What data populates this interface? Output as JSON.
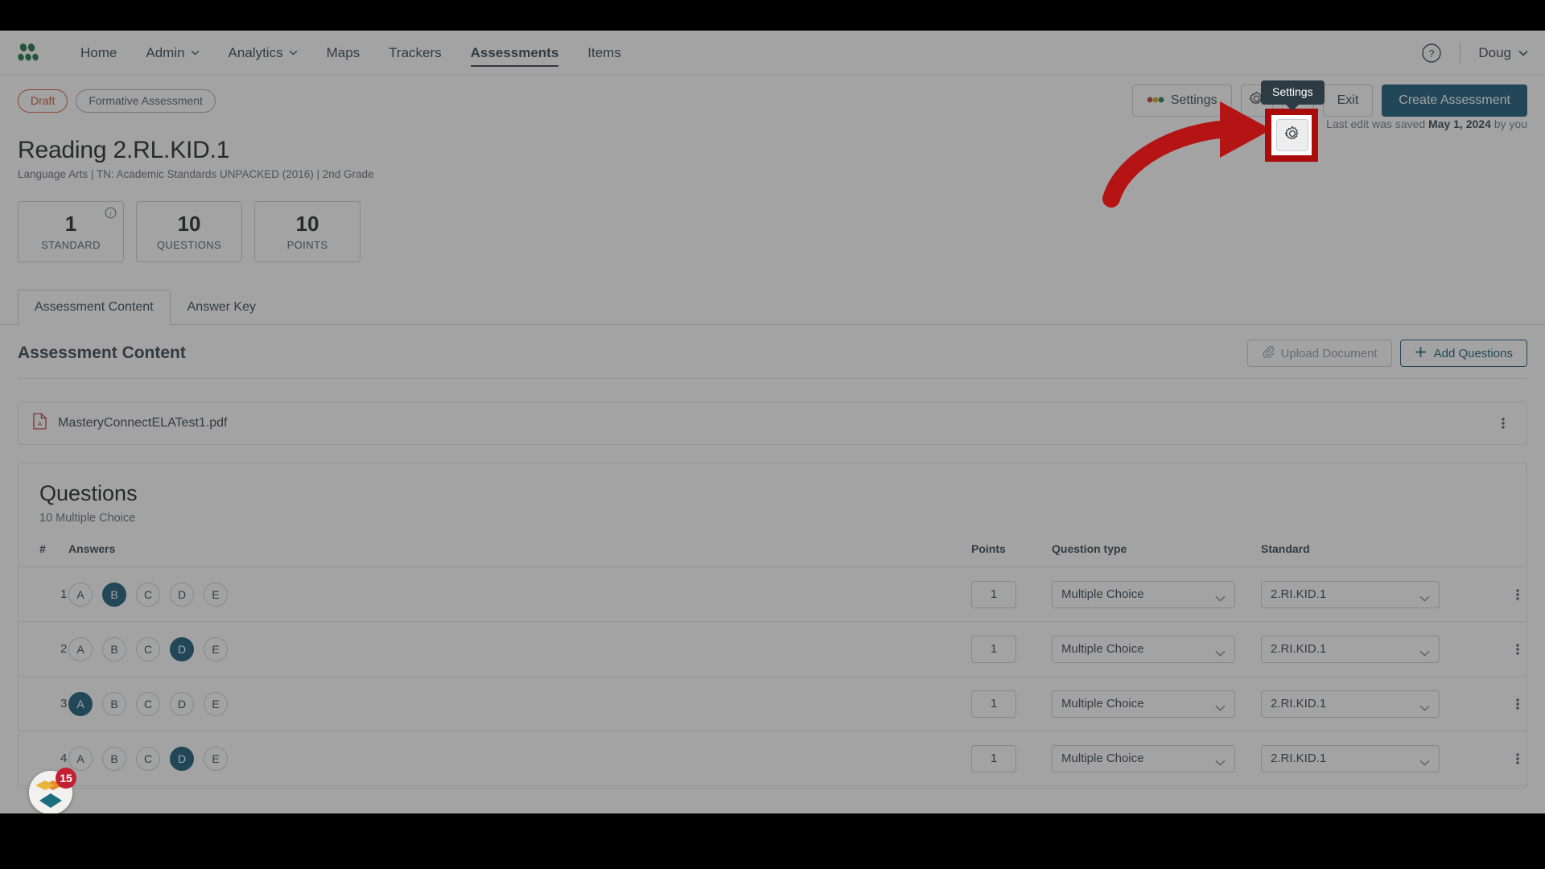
{
  "topnav": {
    "logo_icon": "instructure-logo-icon",
    "items": [
      {
        "label": "Home",
        "has_caret": false,
        "active": false
      },
      {
        "label": "Admin",
        "has_caret": true,
        "active": false
      },
      {
        "label": "Analytics",
        "has_caret": true,
        "active": false
      },
      {
        "label": "Maps",
        "has_caret": false,
        "active": false
      },
      {
        "label": "Trackers",
        "has_caret": false,
        "active": false
      },
      {
        "label": "Assessments",
        "has_caret": false,
        "active": true
      },
      {
        "label": "Items",
        "has_caret": false,
        "active": false
      }
    ],
    "help_icon": "help-circle-icon",
    "user_name": "Doug",
    "user_caret_icon": "chevron-down-icon"
  },
  "actionbar": {
    "status_pill": "Draft",
    "type_pill": "Formative Assessment",
    "settings_label": "Settings",
    "settings_gear_icon": "gear-icon",
    "more_icon": "kebab-vertical-icon",
    "exit_label": "Exit",
    "create_label": "Create Assessment",
    "saved_prefix": "Last edit was saved",
    "saved_date": "May 1, 2024",
    "saved_suffix": "by you"
  },
  "annotation": {
    "tooltip_label": "Settings",
    "highlight_color": "#aa0b0b",
    "arrow_color": "#b51414"
  },
  "title": {
    "heading": "Reading 2.RL.KID.1",
    "subject": "Language Arts",
    "standard_set": "TN: Academic Standards UNPACKED (2016)",
    "grade": "2nd Grade",
    "separator": "|"
  },
  "stats": [
    {
      "value": "1",
      "label": "STANDARD",
      "info_icon": "info-circle-icon"
    },
    {
      "value": "10",
      "label": "QUESTIONS",
      "info_icon": ""
    },
    {
      "value": "10",
      "label": "POINTS",
      "info_icon": ""
    }
  ],
  "tabs": [
    {
      "label": "Assessment Content",
      "active": true
    },
    {
      "label": "Answer Key",
      "active": false
    }
  ],
  "section": {
    "heading": "Assessment Content",
    "upload_label": "Upload Document",
    "upload_icon": "paperclip-icon",
    "add_label": "Add Questions",
    "add_icon": "plus-icon"
  },
  "file": {
    "name": "MasteryConnectELATest1.pdf",
    "icon": "pdf-file-icon",
    "menu_icon": "kebab-vertical-icon"
  },
  "questions": {
    "heading": "Questions",
    "subheading": "10 Multiple Choice",
    "columns": {
      "number": "#",
      "answers": "Answers",
      "points": "Points",
      "question_type": "Question type",
      "standard": "Standard"
    },
    "choice_letters": [
      "A",
      "B",
      "C",
      "D",
      "E"
    ],
    "rows": [
      {
        "number": "1",
        "selected": "B",
        "points": "1",
        "question_type": "Multiple Choice",
        "standard": "2.RI.KID.1"
      },
      {
        "number": "2",
        "selected": "D",
        "points": "1",
        "question_type": "Multiple Choice",
        "standard": "2.RI.KID.1"
      },
      {
        "number": "3",
        "selected": "A",
        "points": "1",
        "question_type": "Multiple Choice",
        "standard": "2.RI.KID.1"
      },
      {
        "number": "4",
        "selected": "D",
        "points": "1",
        "question_type": "Multiple Choice",
        "standard": "2.RI.KID.1"
      }
    ]
  },
  "floating_app": {
    "icon": "mastery-diamond-app-icon",
    "badge_count": "15",
    "badge_color": "#c32032"
  },
  "colors": {
    "primary": "#0b5272",
    "draft": "#cb4b22",
    "text": "#2d3b45",
    "border": "#c7cdd1"
  }
}
